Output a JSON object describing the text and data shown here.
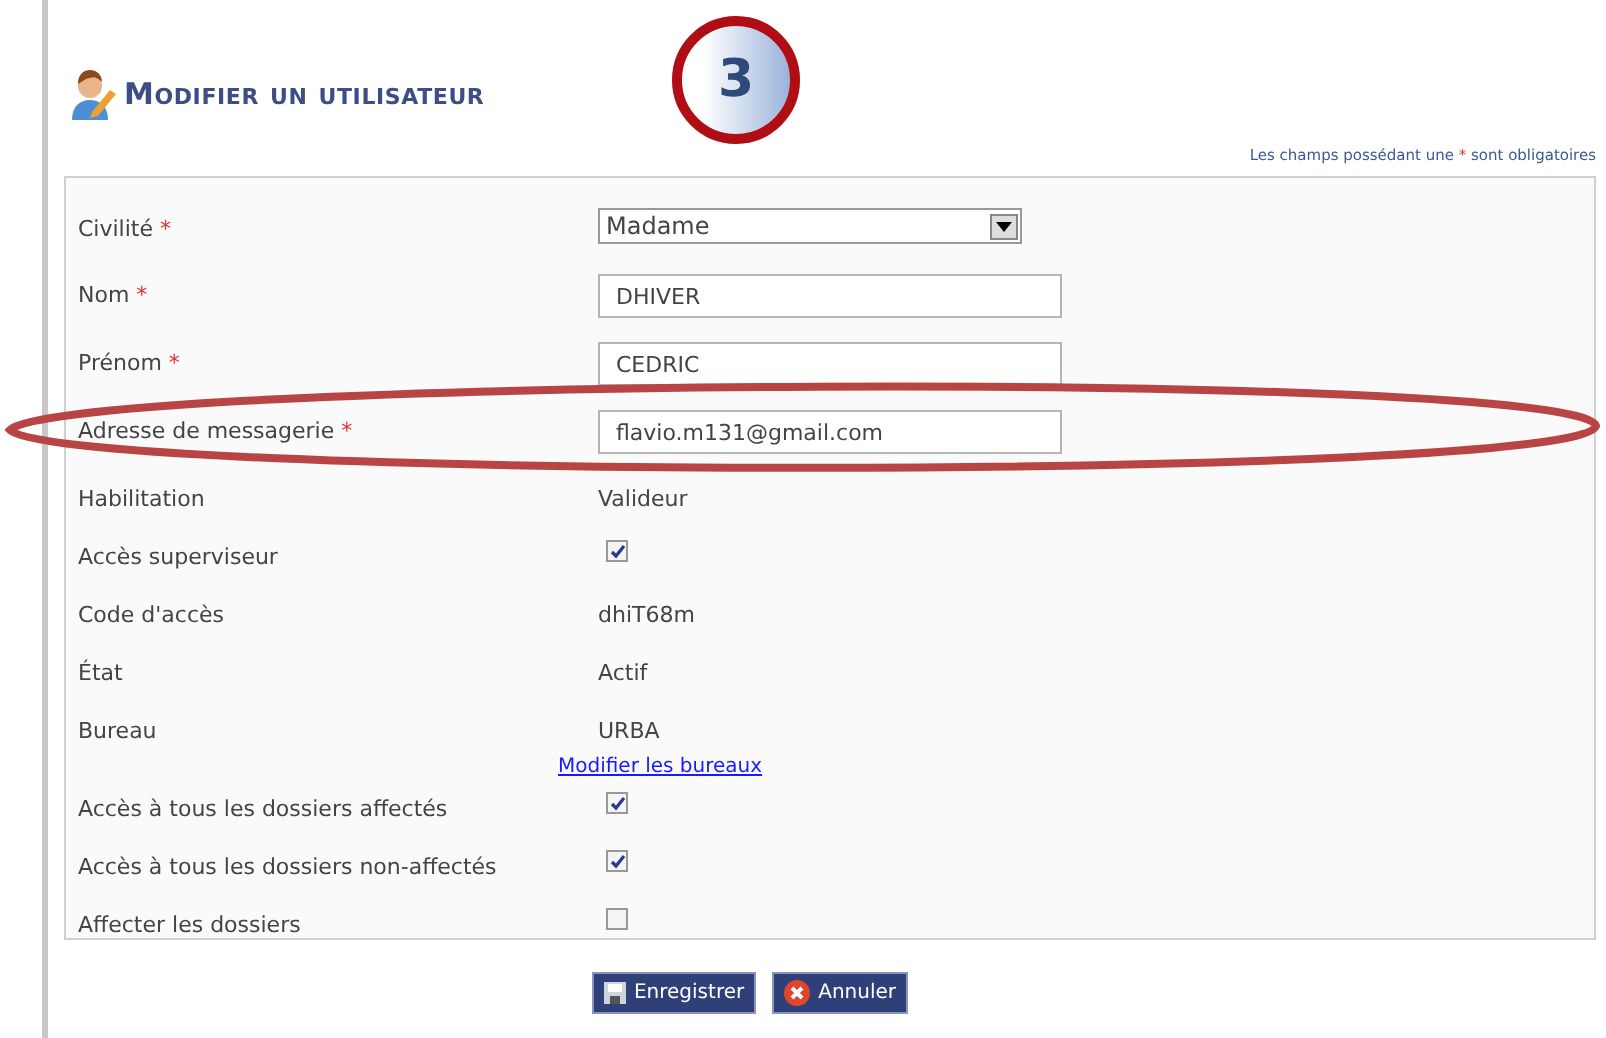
{
  "page_title": "Modifier un utilisateur",
  "step_badge": "3",
  "required_note": {
    "before": "Les champs possédant une",
    "mark": "*",
    "after": "sont obligatoires"
  },
  "fields": [
    {
      "kind": "select",
      "label": "Civilité",
      "required": true,
      "value": "Madame"
    },
    {
      "kind": "input",
      "label": "Nom",
      "required": true,
      "value": "DHIVER"
    },
    {
      "kind": "input",
      "label": "Prénom",
      "required": true,
      "value": "CEDRIC"
    },
    {
      "kind": "input",
      "label": "Adresse de messagerie",
      "required": true,
      "value": "flavio.m131@gmail.com"
    },
    {
      "kind": "text",
      "label": "Habilitation",
      "required": false,
      "value": "Valideur"
    },
    {
      "kind": "checkbox",
      "label": "Accès superviseur",
      "required": false,
      "checked": true
    },
    {
      "kind": "text",
      "label": "Code d'accès",
      "required": false,
      "value": "dhiT68m"
    },
    {
      "kind": "text",
      "label": "État",
      "required": false,
      "value": "Actif"
    },
    {
      "kind": "text",
      "label": "Bureau",
      "required": false,
      "value": "URBA",
      "link": "Modifier les bureaux"
    },
    {
      "kind": "checkbox",
      "label": "Accès à tous les dossiers affectés",
      "required": false,
      "checked": true
    },
    {
      "kind": "checkbox",
      "label": "Accès à tous les dossiers non-affectés",
      "required": false,
      "checked": true
    },
    {
      "kind": "checkbox",
      "label": "Affecter les dossiers",
      "required": false,
      "checked": false
    }
  ],
  "buttons": [
    {
      "kind": "save",
      "label": "Enregistrer"
    },
    {
      "kind": "cancel",
      "label": "Annuler"
    }
  ]
}
